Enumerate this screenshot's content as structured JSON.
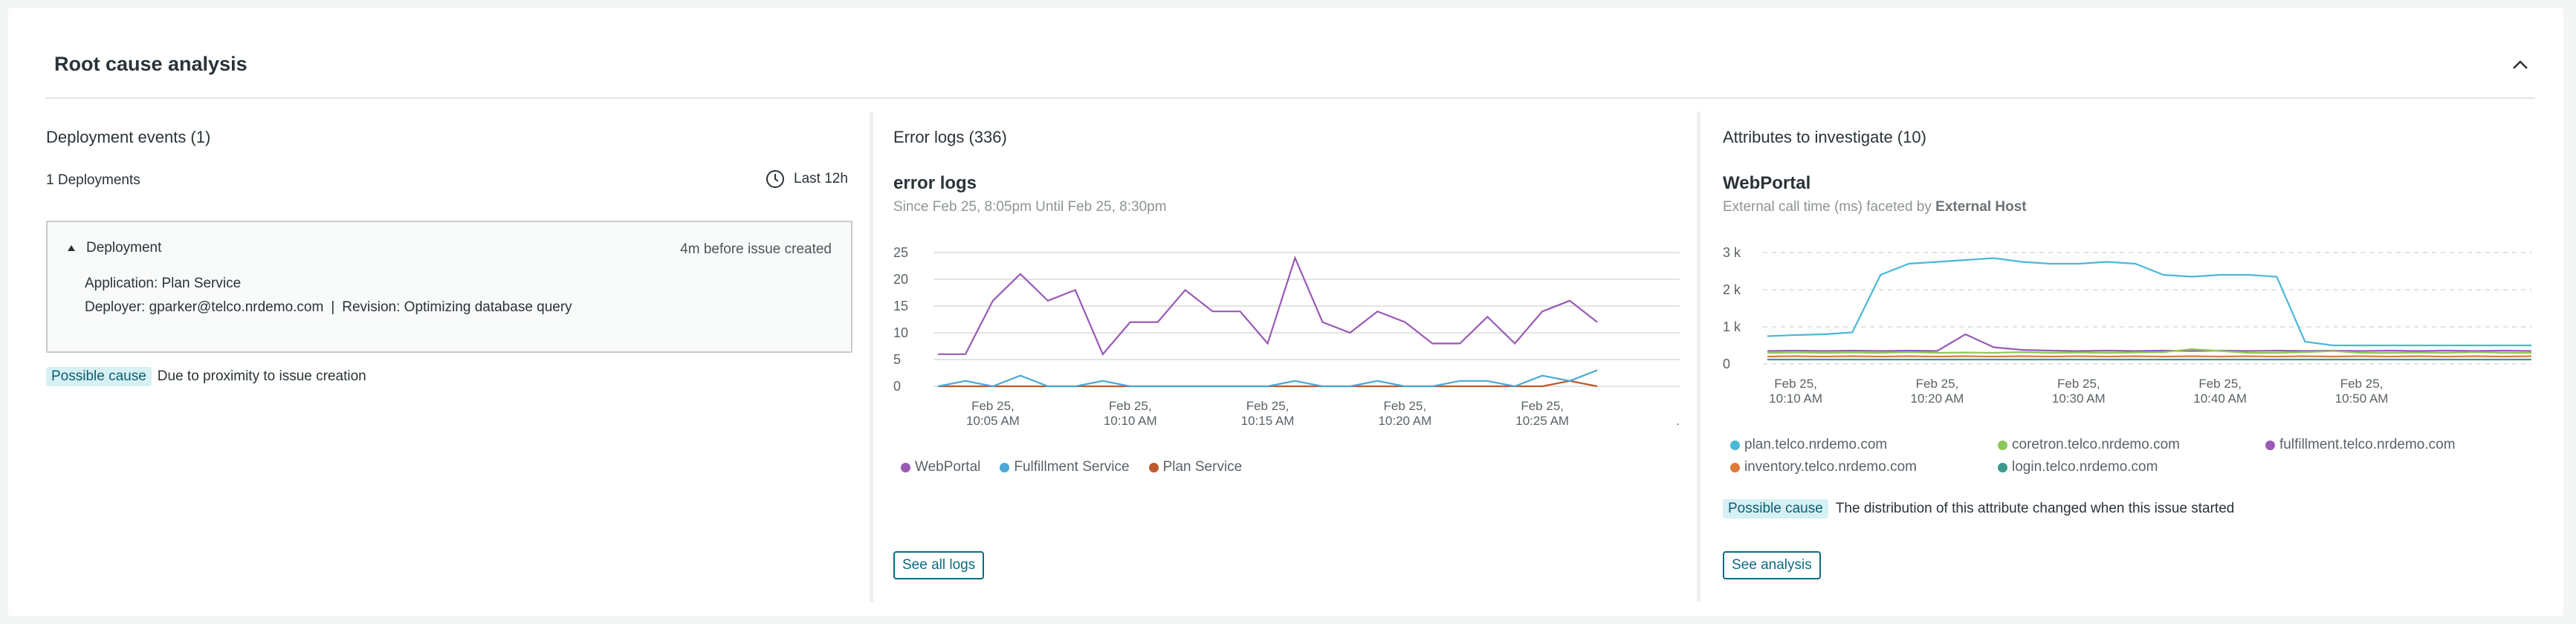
{
  "header": {
    "title": "Root cause analysis"
  },
  "deployments": {
    "title": "Deployment events (1)",
    "count_label": "1 Deployments",
    "range_label": "Last 12h",
    "item": {
      "label": "Deployment",
      "timing": "4m before issue created",
      "application": "Application: Plan Service",
      "deployer": "Deployer: gparker@telco.nrdemo.com",
      "separator": "|",
      "revision": "Revision: Optimizing database query"
    },
    "cause_badge": "Possible cause",
    "cause_text": "Due to proximity to issue creation"
  },
  "error_logs": {
    "title": "Error logs (336)",
    "chart_title": "error logs",
    "chart_subtitle": "Since Feb 25, 8:05pm Until Feb 25, 8:30pm",
    "button": "See all logs",
    "extra_tick": "."
  },
  "attributes": {
    "title": "Attributes to investigate (10)",
    "chart_title": "WebPortal",
    "subtitle_prefix": "External call time (ms) faceted by",
    "subtitle_bold": "External Host",
    "cause_badge": "Possible cause",
    "cause_text": "The distribution of this attribute changed when this issue started",
    "button": "See analysis"
  },
  "chart_data": [
    {
      "type": "line",
      "title": "error logs",
      "yticks": [
        "25",
        "20",
        "15",
        "10",
        "5",
        "0"
      ],
      "ylim": [
        0,
        25
      ],
      "x": [
        "10:03",
        "10:04",
        "10:05",
        "10:06",
        "10:07",
        "10:08",
        "10:09",
        "10:10",
        "10:11",
        "10:12",
        "10:13",
        "10:14",
        "10:15",
        "10:16",
        "10:17",
        "10:18",
        "10:19",
        "10:20",
        "10:21",
        "10:22",
        "10:23",
        "10:24",
        "10:25",
        "10:26",
        "10:27",
        "10:28",
        "10:29",
        "10:30"
      ],
      "xticks": [
        {
          "line1": "Feb 25,",
          "line2": "10:05 AM",
          "at": 2
        },
        {
          "line1": "Feb 25,",
          "line2": "10:10 AM",
          "at": 7
        },
        {
          "line1": "Feb 25,",
          "line2": "10:15 AM",
          "at": 12
        },
        {
          "line1": "Feb 25,",
          "line2": "10:20 AM",
          "at": 17
        },
        {
          "line1": "Feb 25,",
          "line2": "10:25 AM",
          "at": 22
        }
      ],
      "series": [
        {
          "name": "WebPortal",
          "color": "#9b59b6",
          "values": [
            6,
            6,
            16,
            21,
            16,
            18,
            6,
            12,
            12,
            18,
            14,
            14,
            8,
            24,
            12,
            10,
            14,
            12,
            8,
            8,
            13,
            8,
            14,
            16,
            12,
            null,
            null,
            null
          ]
        },
        {
          "name": "Fulfillment Service",
          "color": "#4aa8d8",
          "values": [
            0,
            1,
            0,
            2,
            0,
            0,
            1,
            0,
            0,
            0,
            0,
            0,
            0,
            1,
            0,
            0,
            1,
            0,
            0,
            1,
            1,
            0,
            2,
            1,
            3,
            null,
            null,
            null
          ]
        },
        {
          "name": "Plan Service",
          "color": "#c0572b",
          "values": [
            0,
            0,
            0,
            0,
            0,
            0,
            0,
            0,
            0,
            0,
            0,
            0,
            0,
            0,
            0,
            0,
            0,
            0,
            0,
            0,
            0,
            0,
            0,
            1,
            0,
            null,
            null,
            null
          ]
        }
      ]
    },
    {
      "type": "line",
      "title": "WebPortal",
      "yticks": [
        "3 k",
        "2 k",
        "1 k",
        "0"
      ],
      "ylim": [
        0,
        3000
      ],
      "x": [
        "10:08",
        "10:10",
        "10:12",
        "10:14",
        "10:16",
        "10:18",
        "10:20",
        "10:22",
        "10:24",
        "10:26",
        "10:28",
        "10:30",
        "10:32",
        "10:34",
        "10:36",
        "10:38",
        "10:40",
        "10:42",
        "10:44",
        "10:46",
        "10:48",
        "10:50",
        "10:52",
        "10:54",
        "10:56",
        "10:58",
        "11:00",
        "11:02"
      ],
      "xticks": [
        {
          "line1": "Feb 25,",
          "line2": "10:10 AM",
          "at": 1
        },
        {
          "line1": "Feb 25,",
          "line2": "10:20 AM",
          "at": 6
        },
        {
          "line1": "Feb 25,",
          "line2": "10:30 AM",
          "at": 11
        },
        {
          "line1": "Feb 25,",
          "line2": "10:40 AM",
          "at": 16
        },
        {
          "line1": "Feb 25,",
          "line2": "10:50 AM",
          "at": 21
        }
      ],
      "series": [
        {
          "name": "plan.telco.nrdemo.com",
          "color": "#4ab8d8",
          "values": [
            750,
            780,
            800,
            850,
            2400,
            2700,
            2750,
            2800,
            2850,
            2750,
            2700,
            2700,
            2750,
            2700,
            2400,
            2350,
            2400,
            2400,
            2350,
            600,
            500,
            500,
            500,
            500,
            500,
            500,
            500,
            500
          ]
        },
        {
          "name": "coretron.telco.nrdemo.com",
          "color": "#8dc85a",
          "values": [
            300,
            310,
            300,
            310,
            300,
            320,
            300,
            310,
            300,
            320,
            300,
            310,
            300,
            310,
            320,
            400,
            350,
            300,
            300,
            320,
            350,
            300,
            300,
            310,
            300,
            320,
            300,
            300
          ]
        },
        {
          "name": "fulfillment.telco.nrdemo.com",
          "color": "#9b59b6",
          "values": [
            350,
            360,
            350,
            360,
            350,
            360,
            350,
            800,
            450,
            380,
            360,
            350,
            360,
            350,
            360,
            350,
            360,
            350,
            360,
            350,
            360,
            350,
            360,
            350,
            360,
            350,
            360,
            350
          ]
        },
        {
          "name": "inventory.telco.nrdemo.com",
          "color": "#e07a3c",
          "values": [
            200,
            210,
            200,
            210,
            200,
            210,
            200,
            210,
            200,
            210,
            200,
            210,
            200,
            210,
            200,
            210,
            200,
            210,
            200,
            210,
            200,
            210,
            200,
            210,
            200,
            210,
            200,
            210
          ]
        },
        {
          "name": "login.telco.nrdemo.com",
          "color": "#3a9a8c",
          "values": [
            120,
            120,
            120,
            120,
            120,
            120,
            120,
            120,
            120,
            120,
            120,
            120,
            120,
            120,
            120,
            120,
            120,
            120,
            120,
            120,
            120,
            120,
            120,
            120,
            120,
            120,
            120,
            120
          ]
        }
      ]
    }
  ]
}
